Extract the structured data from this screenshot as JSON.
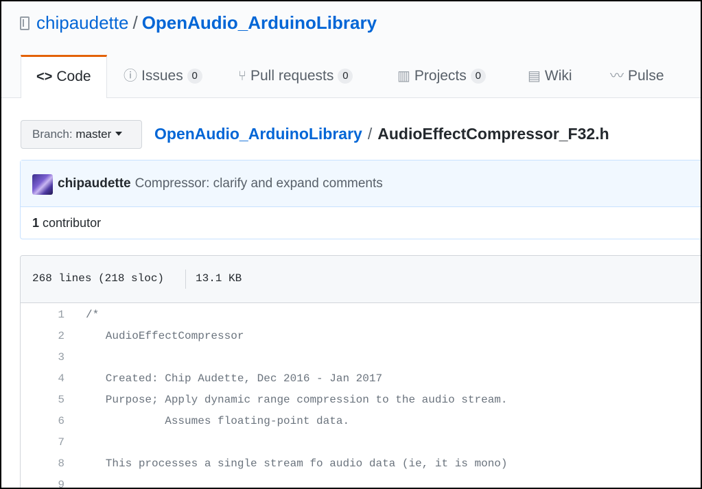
{
  "header": {
    "owner": "chipaudette",
    "separator": "/",
    "repo": "OpenAudio_ArduinoLibrary"
  },
  "tabs": [
    {
      "label": "Code",
      "icon": "code-icon",
      "icon_glyph": "<>"
    },
    {
      "label": "Issues",
      "icon": "issue-icon",
      "icon_glyph": "ⓘ",
      "count": "0"
    },
    {
      "label": "Pull requests",
      "icon": "pull-request-icon",
      "icon_glyph": "⑂",
      "count": "0"
    },
    {
      "label": "Projects",
      "icon": "project-icon",
      "icon_glyph": "▥",
      "count": "0"
    },
    {
      "label": "Wiki",
      "icon": "book-icon",
      "icon_glyph": "▤"
    },
    {
      "label": "Pulse",
      "icon": "pulse-icon",
      "icon_glyph": "〰"
    }
  ],
  "branch": {
    "prefix": "Branch:",
    "name": "master"
  },
  "breadcrumb": {
    "repo": "OpenAudio_ArduinoLibrary",
    "separator": "/",
    "file": "AudioEffectCompressor_F32.h"
  },
  "commit": {
    "author": "chipaudette",
    "message": "Compressor: clarify and expand comments",
    "contributors_count": "1",
    "contributors_label": "contributor"
  },
  "file_info": {
    "lines": "268 lines (218 sloc)",
    "size": "13.1 KB"
  },
  "code_lines": [
    {
      "num": "1",
      "text": "/*"
    },
    {
      "num": "2",
      "text": "   AudioEffectCompressor"
    },
    {
      "num": "3",
      "text": ""
    },
    {
      "num": "4",
      "text": "   Created: Chip Audette, Dec 2016 - Jan 2017"
    },
    {
      "num": "5",
      "text": "   Purpose; Apply dynamic range compression to the audio stream."
    },
    {
      "num": "6",
      "text": "            Assumes floating-point data."
    },
    {
      "num": "7",
      "text": ""
    },
    {
      "num": "8",
      "text": "   This processes a single stream fo audio data (ie, it is mono)"
    },
    {
      "num": "9",
      "text": ""
    }
  ]
}
